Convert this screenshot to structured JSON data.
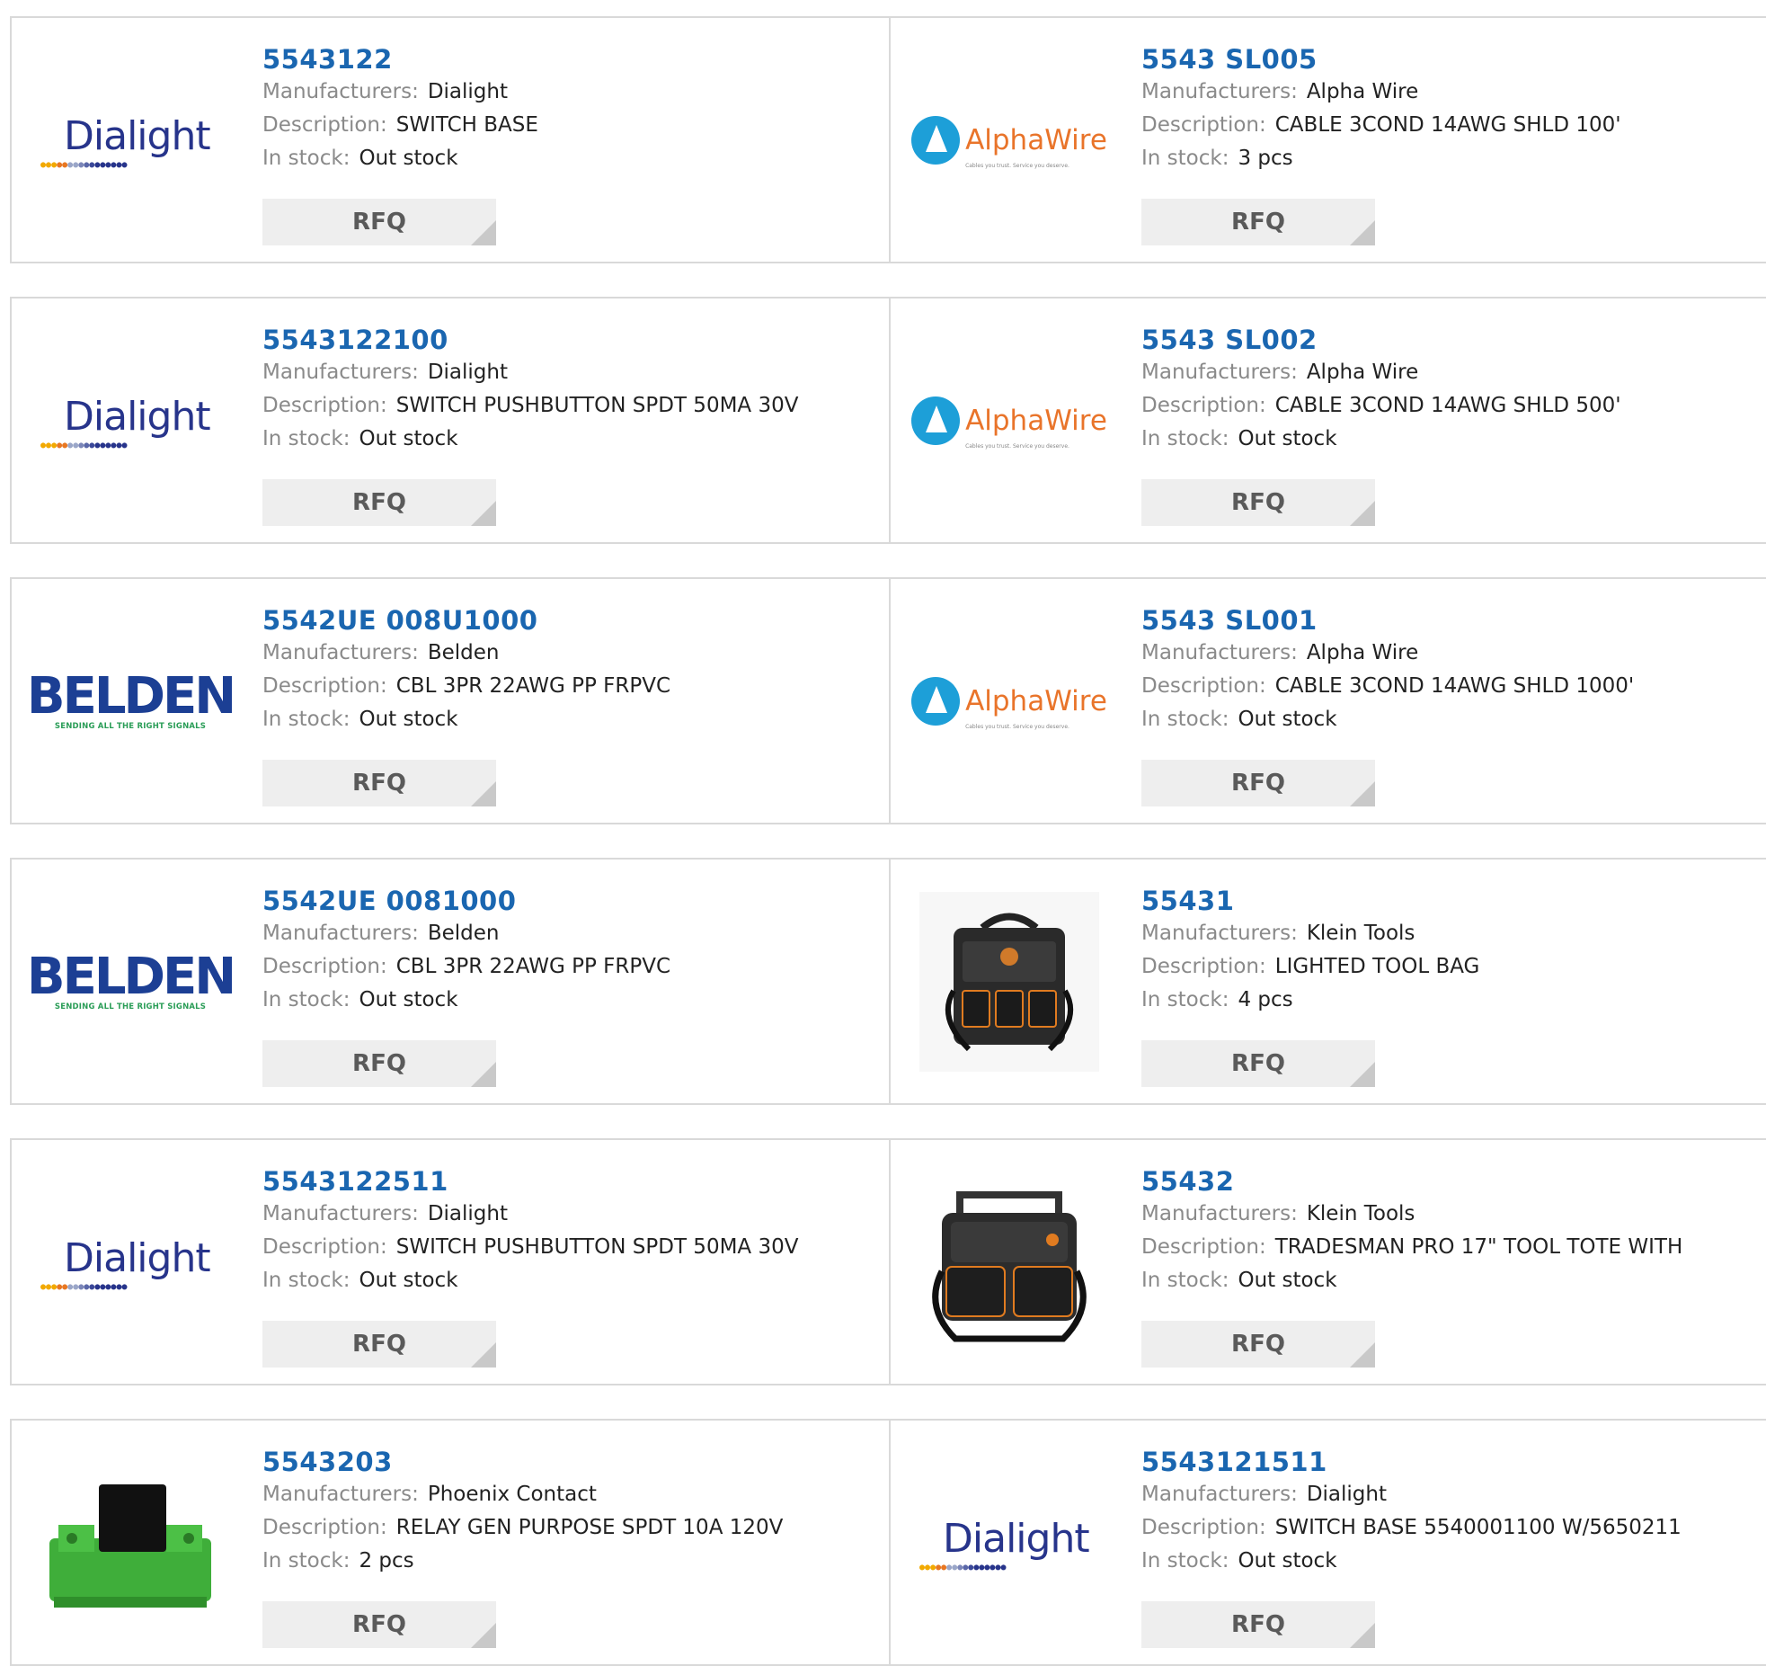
{
  "labels": {
    "manufacturers": "Manufacturers:",
    "description": "Description:",
    "in_stock": "In stock:",
    "rfq": "RFQ"
  },
  "logos": {
    "dialight": "Dialight",
    "alphawire": "AlphaWire",
    "alphawire_tag": "Cables you trust. Service you deserve.",
    "belden": "BELDEN",
    "belden_tag": "SENDING ALL THE RIGHT SIGNALS"
  },
  "products": [
    {
      "part": "5543122",
      "manufacturer": "Dialight",
      "description": "SWITCH BASE",
      "stock": "Out stock",
      "image": "dialight-logo"
    },
    {
      "part": "5543 SL005",
      "manufacturer": "Alpha Wire",
      "description": "CABLE 3COND 14AWG SHLD 100'",
      "stock": "3 pcs",
      "image": "alphawire-logo"
    },
    {
      "part": "5543122100",
      "manufacturer": "Dialight",
      "description": "SWITCH PUSHBUTTON SPDT 50MA 30V",
      "stock": "Out stock",
      "image": "dialight-logo"
    },
    {
      "part": "5543 SL002",
      "manufacturer": "Alpha Wire",
      "description": "CABLE 3COND 14AWG SHLD 500'",
      "stock": "Out stock",
      "image": "alphawire-logo"
    },
    {
      "part": "5542UE 008U1000",
      "manufacturer": "Belden",
      "description": "CBL 3PR 22AWG PP FRPVC",
      "stock": "Out stock",
      "image": "belden-logo"
    },
    {
      "part": "5543 SL001",
      "manufacturer": "Alpha Wire",
      "description": "CABLE 3COND 14AWG SHLD 1000'",
      "stock": "Out stock",
      "image": "alphawire-logo"
    },
    {
      "part": "5542UE 0081000",
      "manufacturer": "Belden",
      "description": "CBL 3PR 22AWG PP FRPVC",
      "stock": "Out stock",
      "image": "belden-logo"
    },
    {
      "part": "55431",
      "manufacturer": "Klein Tools",
      "description": "LIGHTED TOOL BAG",
      "stock": "4 pcs",
      "image": "tool-bag-photo"
    },
    {
      "part": "5543122511",
      "manufacturer": "Dialight",
      "description": "SWITCH PUSHBUTTON SPDT 50MA 30V",
      "stock": "Out stock",
      "image": "dialight-logo"
    },
    {
      "part": "55432",
      "manufacturer": "Klein Tools",
      "description": "TRADESMAN PRO 17\" TOOL TOTE WITH",
      "stock": "Out stock",
      "image": "tool-tote-photo"
    },
    {
      "part": "5543203",
      "manufacturer": "Phoenix Contact",
      "description": "RELAY GEN PURPOSE SPDT 10A 120V",
      "stock": "2 pcs",
      "image": "relay-module-photo"
    },
    {
      "part": "5543121511",
      "manufacturer": "Dialight",
      "description": "SWITCH BASE 5540001100 W/5650211",
      "stock": "Out stock",
      "image": "dialight-logo"
    }
  ],
  "colors": {
    "part_link": "#1a66b0",
    "label": "#8a8a8a",
    "value": "#222222",
    "rfq_bg": "#eeeeee",
    "border": "#d9d9d9"
  }
}
